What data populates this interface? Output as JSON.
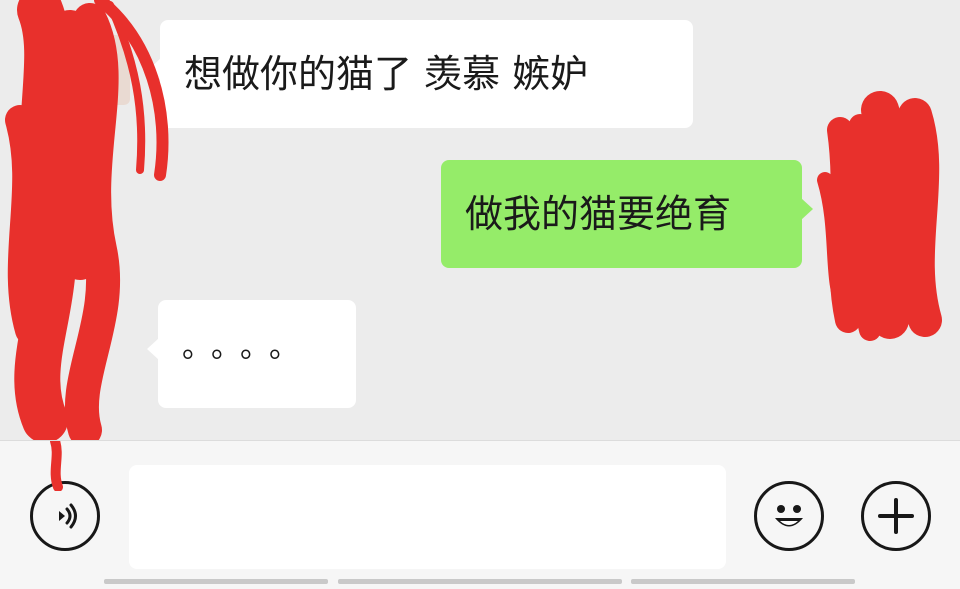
{
  "messages": [
    {
      "direction": "incoming",
      "text": "想做你的猫了  羡慕 嫉妒"
    },
    {
      "direction": "outgoing",
      "text": "做我的猫要绝育"
    },
    {
      "direction": "incoming",
      "text": "。。。。"
    }
  ],
  "input": {
    "value": "",
    "placeholder": ""
  },
  "icons": {
    "voice": "voice-input-icon",
    "emoji": "emoji-icon",
    "more": "plus-icon"
  },
  "colors": {
    "chat_background": "#ececec",
    "incoming_bubble": "#ffffff",
    "outgoing_bubble": "#95ec69",
    "redaction": "#e8302c",
    "icon_stroke": "#181818"
  }
}
